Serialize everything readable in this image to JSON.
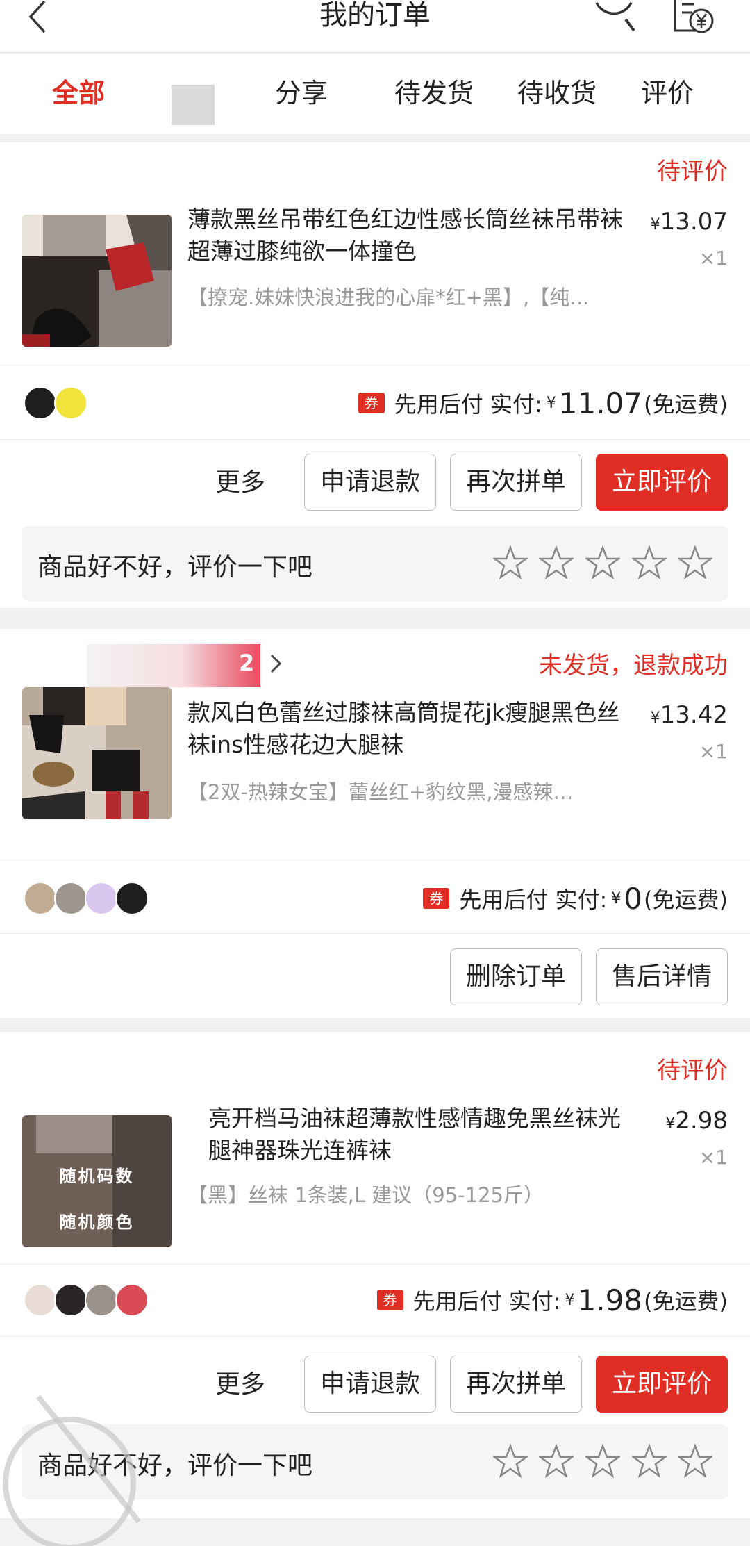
{
  "header": {
    "title": "我的订单",
    "back_icon": "chevron-left-icon",
    "search_icon": "search-icon",
    "bill_icon": "bill-yen-icon"
  },
  "tabs": [
    {
      "label": "全部",
      "active": true
    },
    {
      "label": "分享",
      "active": false
    },
    {
      "label": "待发货",
      "active": false
    },
    {
      "label": "待收货",
      "active": false
    },
    {
      "label": "评价",
      "active": false
    }
  ],
  "orders": [
    {
      "status": "待评价",
      "name": "薄款黑丝吊带红色红边性感长筒丝袜吊带袜超薄过膝纯欲一体撞色",
      "price_symbol": "¥",
      "price": "13.07",
      "qty": "×1",
      "spec": "【撩宠.妹妹快浪进我的心扉*红+黑】,【纯…",
      "coupon": "券",
      "pay_label": "先用后付 实付:",
      "pay_symbol": "¥",
      "pay_amount": "11.07",
      "shipping": "(免运费)",
      "buttons": [
        "更多",
        "申请退款",
        "再次拼单",
        "立即评价"
      ],
      "review_prompt": "商品好不好，评价一下吧"
    },
    {
      "status": "未发货，退款成功",
      "shop_badge": "2",
      "name": "款风白色蕾丝过膝袜高筒提花jk瘦腿黑色丝袜ins性感花边大腿袜",
      "price_symbol": "¥",
      "price": "13.42",
      "qty": "×1",
      "spec": "【2双-热辣女宝】蕾丝红+豹纹黑,漫感辣…",
      "coupon": "券",
      "pay_label": "先用后付 实付:",
      "pay_symbol": "¥",
      "pay_amount": "0",
      "shipping": "(免运费)",
      "buttons": [
        "删除订单",
        "售后详情"
      ]
    },
    {
      "status": "待评价",
      "name": "亮开档马油袜超薄款性感情趣免黑丝袜光腿神器珠光连裤袜",
      "thumb_text_1": "随机码数",
      "thumb_text_2": "随机颜色",
      "price_symbol": "¥",
      "price": "2.98",
      "qty": "×1",
      "spec": "【黑】丝袜 1条装,L 建议（95-125斤）",
      "coupon": "券",
      "pay_label": "先用后付 实付:",
      "pay_symbol": "¥",
      "pay_amount": "1.98",
      "shipping": "(免运费)",
      "buttons": [
        "更多",
        "申请退款",
        "再次拼单",
        "立即评价"
      ],
      "review_prompt": "商品好不好，评价一下吧"
    }
  ],
  "colors": {
    "accent": "#e02e24",
    "muted": "#999999"
  }
}
